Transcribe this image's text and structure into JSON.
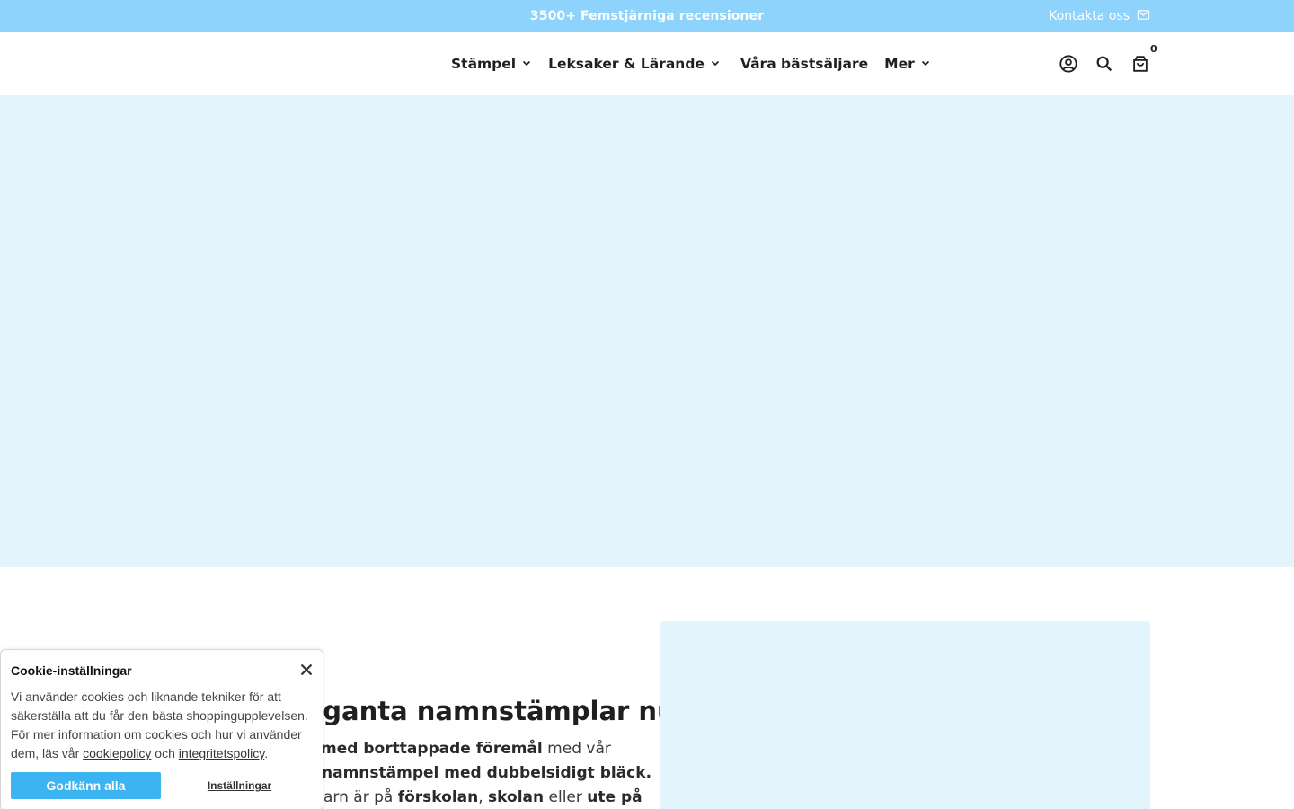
{
  "announcement": {
    "message": "3500+ Femstjärniga recensioner",
    "contact_label": "Kontakta oss",
    "contact_icon": "mail-icon"
  },
  "nav": {
    "items": [
      {
        "label": "Stämpel",
        "has_dropdown": true
      },
      {
        "label": "Leksaker & Lärande",
        "has_dropdown": true
      },
      {
        "label": "Våra bästsäljare",
        "has_dropdown": false
      },
      {
        "label": "Mer",
        "has_dropdown": true
      }
    ]
  },
  "header_icons": {
    "account_icon": "user-circle-icon",
    "search_icon": "search-icon",
    "cart_icon": "shopping-bag-icon",
    "cart_count": "0"
  },
  "content": {
    "headline": "eleganta namnstämplar nu!",
    "line1_bold": "t med borttappade föremål",
    "line1_rest": " med vår",
    "line2_bold": "namnstämpel med dubbelsidigt bläck.",
    "line3_a": "arn är på ",
    "line3_b": "förskolan",
    "line3_c": ", ",
    "line3_d": "skolan",
    "line3_e": " eller ",
    "line3_f": "ute på"
  },
  "cookie": {
    "title": "Cookie-inställningar",
    "body_start": "Vi använder cookies och liknande tekniker för att säkerställa att du får den bästa shoppingupplevelsen. För mer information om cookies och hur vi använder dem, läs vår ",
    "cookie_link": "cookiepolicy",
    "body_mid": " och ",
    "privacy_link": "integritetspolicy",
    "body_end": ".",
    "accept_label": "Godkänn alla",
    "settings_label": "Inställningar"
  },
  "colors": {
    "announcement_bg": "#8ed3fb",
    "hero_bg": "#e3f4fc",
    "accept_button": "#3db4f2"
  }
}
